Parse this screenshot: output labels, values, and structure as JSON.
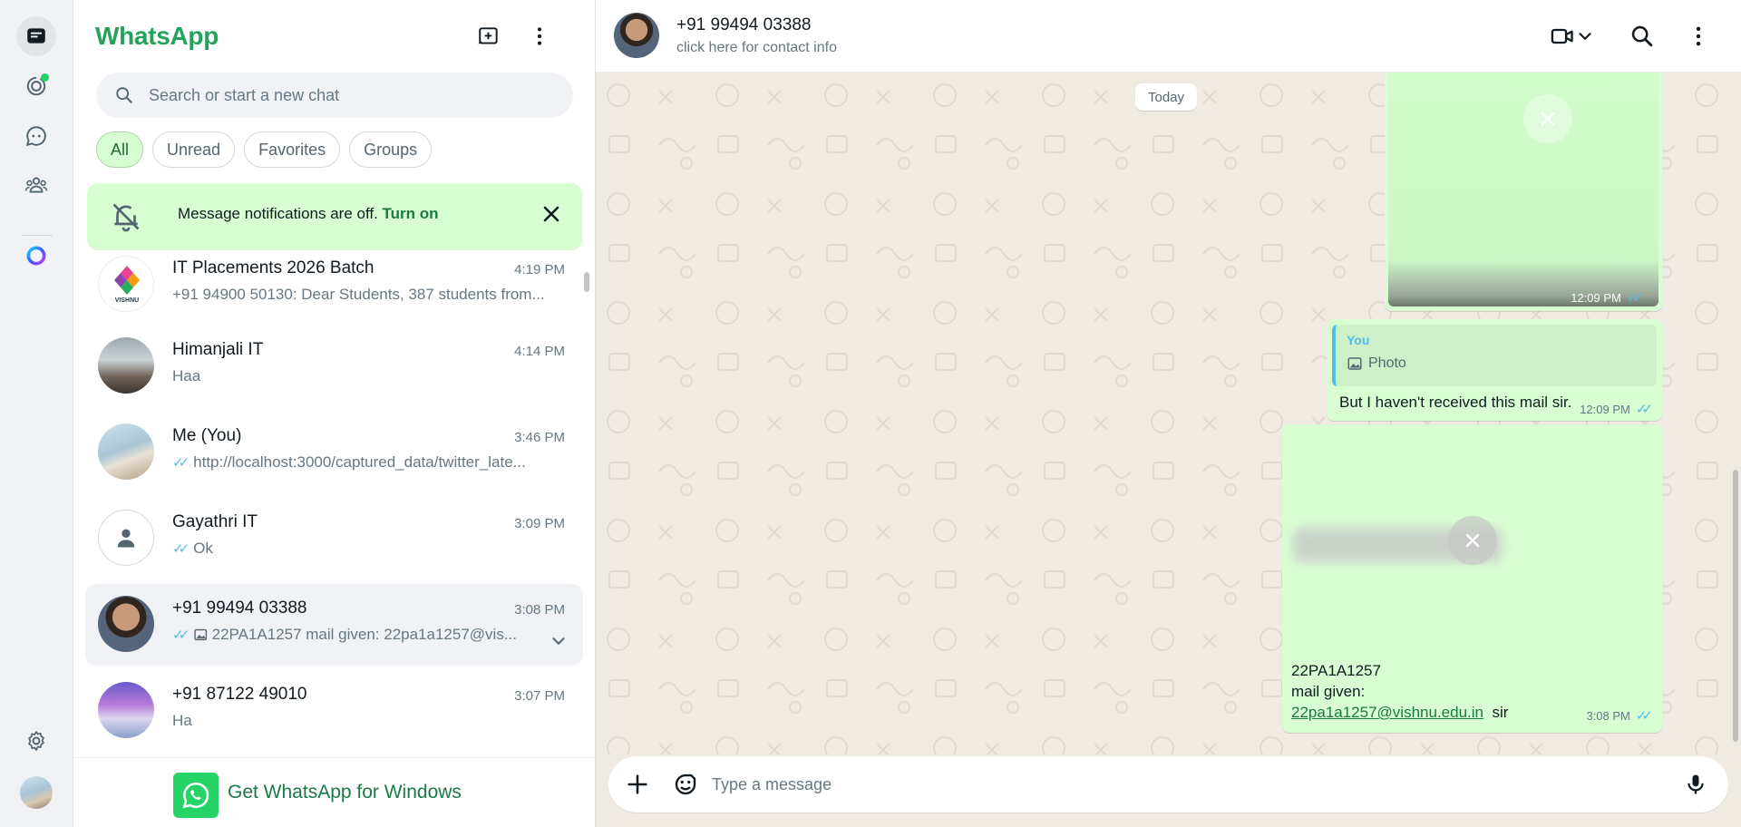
{
  "app": {
    "title": "WhatsApp"
  },
  "search": {
    "placeholder": "Search or start a new chat"
  },
  "filters": [
    "All",
    "Unread",
    "Favorites",
    "Groups"
  ],
  "notification": {
    "message": "Message notifications are off.",
    "action": "Turn on"
  },
  "chats": [
    {
      "name": "IT Placements 2026 Batch",
      "time": "4:19 PM",
      "preview": "+91 94900 50130: Dear Students, 387 students from...",
      "ticks": false,
      "photo": false,
      "avatar_label": "VISHNU"
    },
    {
      "name": "Himanjali IT",
      "time": "4:14 PM",
      "preview": "Haa",
      "ticks": false,
      "photo": false
    },
    {
      "name": "Me (You)",
      "time": "3:46 PM",
      "preview": "http://localhost:3000/captured_data/twitter_late...",
      "ticks": true,
      "photo": false
    },
    {
      "name": "Gayathri IT",
      "time": "3:09 PM",
      "preview": "Ok",
      "ticks": true,
      "photo": false
    },
    {
      "name": "+91 99494 03388",
      "time": "3:08 PM",
      "preview": "22PA1A1257 mail given: 22pa1a1257@vis...",
      "ticks": true,
      "photo": true,
      "selected": true
    },
    {
      "name": "+91 87122 49010",
      "time": "3:07 PM",
      "preview": "Ha",
      "ticks": false,
      "photo": false
    }
  ],
  "get_app": {
    "label": "Get WhatsApp for Windows"
  },
  "conversation": {
    "name": "+91 99494 03388",
    "subtitle": "click here for contact info",
    "date_divider": "Today",
    "messages": [
      {
        "type": "image",
        "time": "12:09 PM"
      },
      {
        "type": "reply",
        "quote_author": "You",
        "quote_text": "Photo",
        "text": "But I haven't received this mail sir.",
        "time": "12:09 PM"
      },
      {
        "type": "image_caption",
        "line1": "22PA1A1257",
        "line2": "mail given:",
        "link": "22pa1a1257@vishnu.edu.in",
        "suffix": "sir",
        "time": "3:08 PM"
      }
    ]
  },
  "composer": {
    "placeholder": "Type a message"
  },
  "colors": {
    "brand": "#25a35a",
    "bubble_out": "#d9fdd3",
    "tick_read": "#53bdeb",
    "chat_bg": "#efeae2"
  },
  "icons": [
    "chats-icon",
    "status-icon",
    "channels-icon",
    "communities-icon",
    "meta-ai-icon",
    "settings-icon",
    "new-chat-icon",
    "menu-icon",
    "search-icon",
    "bell-off-icon",
    "close-icon",
    "chevron-down-icon",
    "video-call-icon",
    "attach-plus-icon",
    "sticker-icon",
    "mic-icon"
  ]
}
